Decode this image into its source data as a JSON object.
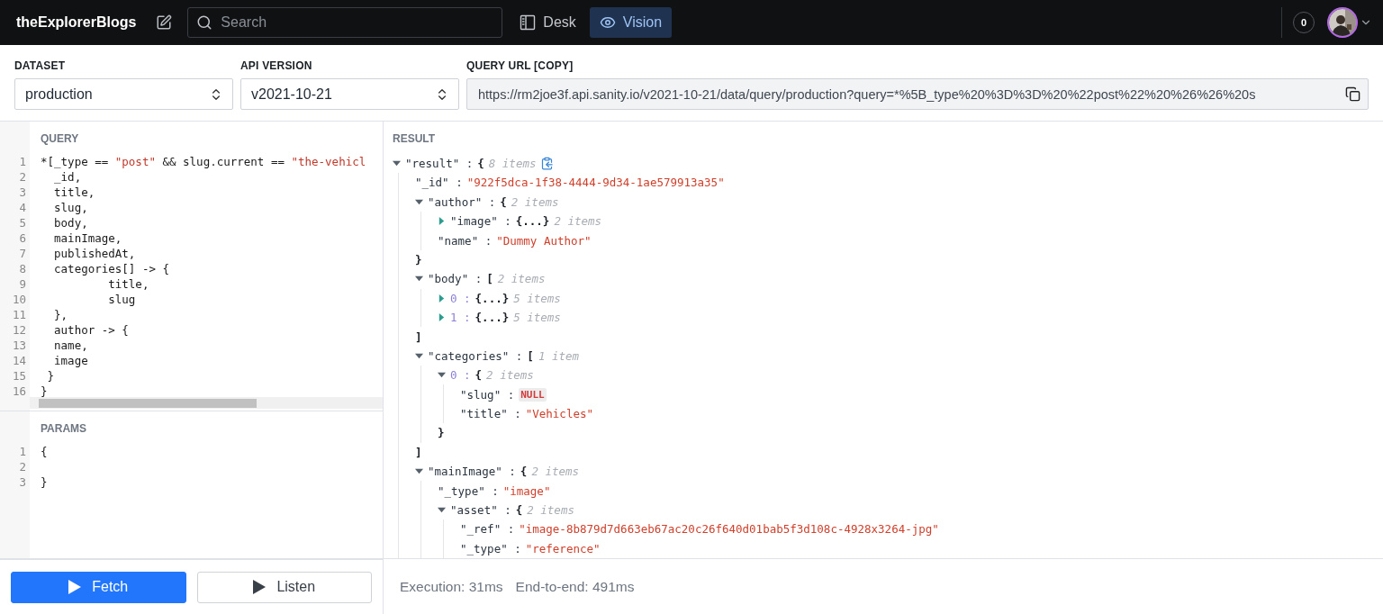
{
  "app": {
    "brand": "theExplorerBlogs",
    "search": {
      "placeholder": "Search"
    },
    "tools": [
      {
        "kind": "desk",
        "label": "Desk",
        "selected": false
      },
      {
        "kind": "vision",
        "label": "Vision",
        "selected": true
      }
    ],
    "notifications": "0"
  },
  "settings": [
    {
      "kind": "select",
      "label": "DATASET",
      "value": "production"
    },
    {
      "kind": "select",
      "label": "API VERSION",
      "value": "v2021-10-21"
    },
    {
      "kind": "url",
      "label": "QUERY URL [COPY]",
      "value": "https://rm2joe3f.api.sanity.io/v2021-10-21/data/query/production?query=*%5B_type%20%3D%3D%20%22post%22%20%26%26%20s"
    }
  ],
  "query": {
    "title": "QUERY",
    "lines": [
      {
        "no": "1",
        "tokens": [
          {
            "kind": "plain",
            "text": "*[_type == "
          },
          {
            "kind": "string",
            "text": "\"post\""
          },
          {
            "kind": "plain",
            "text": " && slug.current == "
          },
          {
            "kind": "string",
            "text": "\"the-vehicl"
          }
        ]
      },
      {
        "no": "2",
        "tokens": [
          {
            "kind": "plain",
            "text": "  _id,"
          }
        ]
      },
      {
        "no": "3",
        "tokens": [
          {
            "kind": "plain",
            "text": "  title,"
          }
        ]
      },
      {
        "no": "4",
        "tokens": [
          {
            "kind": "plain",
            "text": "  slug,"
          }
        ]
      },
      {
        "no": "5",
        "tokens": [
          {
            "kind": "plain",
            "text": "  body,"
          }
        ]
      },
      {
        "no": "6",
        "tokens": [
          {
            "kind": "plain",
            "text": "  mainImage,"
          }
        ]
      },
      {
        "no": "7",
        "tokens": [
          {
            "kind": "plain",
            "text": "  publishedAt,"
          }
        ]
      },
      {
        "no": "8",
        "tokens": [
          {
            "kind": "plain",
            "text": "  categories[] -> {"
          }
        ]
      },
      {
        "no": "9",
        "tokens": [
          {
            "kind": "plain",
            "text": "          title,"
          }
        ]
      },
      {
        "no": "10",
        "tokens": [
          {
            "kind": "plain",
            "text": "          slug"
          }
        ]
      },
      {
        "no": "11",
        "tokens": [
          {
            "kind": "plain",
            "text": "  },"
          }
        ]
      },
      {
        "no": "12",
        "tokens": [
          {
            "kind": "plain",
            "text": "  author -> {"
          }
        ]
      },
      {
        "no": "13",
        "tokens": [
          {
            "kind": "plain",
            "text": "  name,"
          }
        ]
      },
      {
        "no": "14",
        "tokens": [
          {
            "kind": "plain",
            "text": "  image"
          }
        ]
      },
      {
        "no": "15",
        "tokens": [
          {
            "kind": "plain",
            "text": " }"
          }
        ]
      },
      {
        "no": "16",
        "tokens": [
          {
            "kind": "plain",
            "text": "}"
          }
        ]
      }
    ]
  },
  "params": {
    "title": "PARAMS",
    "lines": [
      {
        "no": "1",
        "tokens": [
          {
            "kind": "plain",
            "text": "{"
          }
        ]
      },
      {
        "no": "2"
      },
      {
        "no": "3",
        "tokens": [
          {
            "kind": "plain",
            "text": "}"
          }
        ]
      }
    ]
  },
  "buttons": [
    {
      "kind": "primary",
      "label": "Fetch"
    },
    {
      "kind": "secondary",
      "label": "Listen"
    }
  ],
  "result": {
    "title": "RESULT",
    "tree": [
      {
        "key": "\"result\" :",
        "open": "{",
        "count": "8 items",
        "expanded": true,
        "copy": true,
        "children": [
          {
            "key": "\"_id\" :",
            "value": "\"922f5dca-1f38-4444-9d34-1ae579913a35\""
          },
          {
            "key": "\"author\" :",
            "open": "{",
            "count": "2 items",
            "expanded": true,
            "close": "}",
            "children": [
              {
                "key": "\"image\" :",
                "open": "{...}",
                "count": "2 items",
                "expanded": false
              },
              {
                "key": "\"name\" :",
                "value": "\"Dummy Author\""
              }
            ]
          },
          {
            "key": "\"body\" :",
            "open": "[",
            "count": "2 items",
            "expanded": true,
            "close": "]",
            "children": [
              {
                "index": "0 :",
                "open": "{...}",
                "count": "5 items",
                "expanded": false
              },
              {
                "index": "1 :",
                "open": "{...}",
                "count": "5 items",
                "expanded": false
              }
            ]
          },
          {
            "key": "\"categories\" :",
            "open": "[",
            "count": "1 item",
            "expanded": true,
            "close": "]",
            "children": [
              {
                "index": "0 :",
                "open": "{",
                "count": "2 items",
                "expanded": true,
                "close": "}",
                "children": [
                  {
                    "key": "\"slug\" :",
                    "null": "NULL"
                  },
                  {
                    "key": "\"title\" :",
                    "value": "\"Vehicles\""
                  }
                ]
              }
            ]
          },
          {
            "key": "\"mainImage\" :",
            "open": "{",
            "count": "2 items",
            "expanded": true,
            "children": [
              {
                "key": "\"_type\" :",
                "value": "\"image\""
              },
              {
                "key": "\"asset\" :",
                "open": "{",
                "count": "2 items",
                "expanded": true,
                "children": [
                  {
                    "key": "\"_ref\" :",
                    "value": "\"image-8b879d7d663eb67ac20c26f640d01bab5f3d108c-4928x3264-jpg\""
                  },
                  {
                    "key": "\"_type\" :",
                    "value": "\"reference\""
                  }
                ]
              }
            ]
          }
        ]
      }
    ]
  },
  "stats": [
    "Execution: 31ms",
    "End-to-end: 491ms"
  ]
}
